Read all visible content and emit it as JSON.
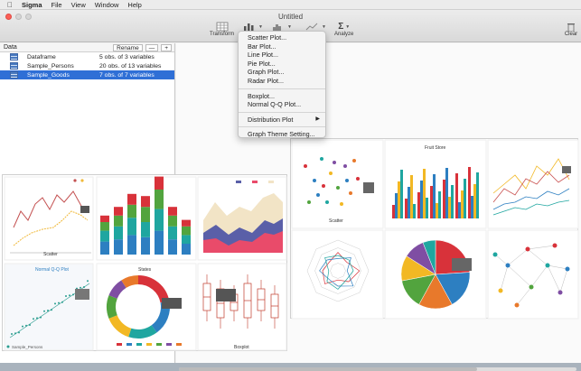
{
  "menubar": {
    "app": "Sigma",
    "items": [
      "File",
      "View",
      "Window",
      "Help"
    ]
  },
  "window": {
    "title": "Untitled"
  },
  "toolbar": {
    "transform": "Transform",
    "analyze": "Analyze",
    "clear": "Clear"
  },
  "dataPanel": {
    "header": "Data",
    "rename": "Rename",
    "minus": "—",
    "plus": "+",
    "rows": [
      {
        "name": "Dataframe",
        "info": "5 obs. of 3 variables"
      },
      {
        "name": "Sample_Persons",
        "info": "20 obs. of 13 variables"
      },
      {
        "name": "Sample_Goods",
        "info": "7 obs. of 7 variables"
      }
    ]
  },
  "plotMenu": {
    "items": [
      "Scatter Plot...",
      "Bar Plot...",
      "Line Plot...",
      "Pie Plot...",
      "Graph Plot...",
      "Radar Plot..."
    ],
    "items2": [
      "Boxplot...",
      "Normal Q-Q Plot..."
    ],
    "distribution": "Distribution Plot",
    "theme": "Graph Theme Setting..."
  },
  "thumbnails": {
    "scatterLeft": "Scatter",
    "qqTitle": "Normal Q-Q Plot",
    "qqLegend": "Sample_Persons",
    "stateTitle": "States",
    "boxplotTitle": "Boxplot",
    "scatterRight": "Scatter",
    "fruitTitle": "Fruit Store"
  },
  "colors": {
    "accent": "#2f6fd6",
    "red": "#d8323a",
    "blue": "#2d7fc1",
    "teal": "#1fa6a0",
    "yellow": "#f2b824",
    "green": "#52a43e"
  }
}
